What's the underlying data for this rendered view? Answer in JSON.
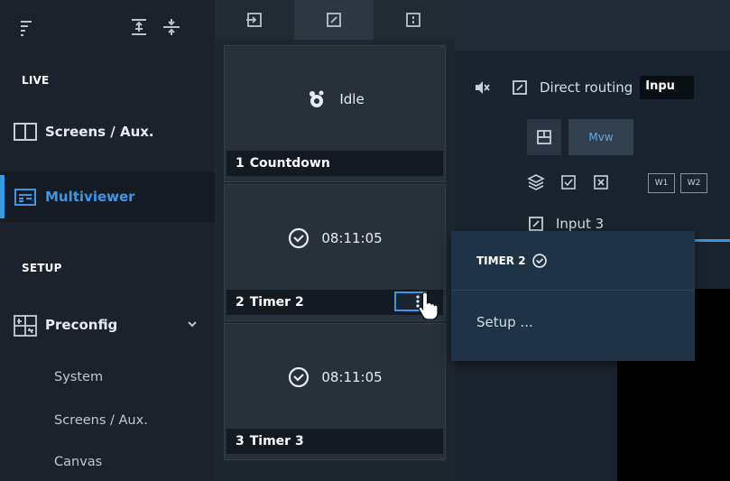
{
  "sidebar": {
    "sections": {
      "live": "LIVE",
      "setup": "SETUP"
    },
    "nav": {
      "screens_aux": "Screens / Aux.",
      "multiviewer": "Multiviewer",
      "preconfig": "Preconfig"
    },
    "sub_items": [
      "System",
      "Screens / Aux.",
      "Canvas"
    ]
  },
  "timers": [
    {
      "index": "1",
      "name": "Countdown",
      "state": "Idle",
      "icon": "sprout-icon"
    },
    {
      "index": "2",
      "name": "Timer 2",
      "state": "08:11:05",
      "icon": "clock-icon"
    },
    {
      "index": "3",
      "name": "Timer 3",
      "state": "08:11:05",
      "icon": "clock-icon"
    }
  ],
  "right": {
    "routing_label": "Direct routing",
    "input_tag": "Inpu",
    "mvw": "Mvw",
    "w1": "W1",
    "w2": "W2",
    "input3": "Input 3"
  },
  "popup": {
    "title": "TIMER 2",
    "item": "Setup ..."
  },
  "colors": {
    "accent": "#3c98e6",
    "sidebar_bg": "#1b222b",
    "popup_bg": "#1f3346"
  }
}
